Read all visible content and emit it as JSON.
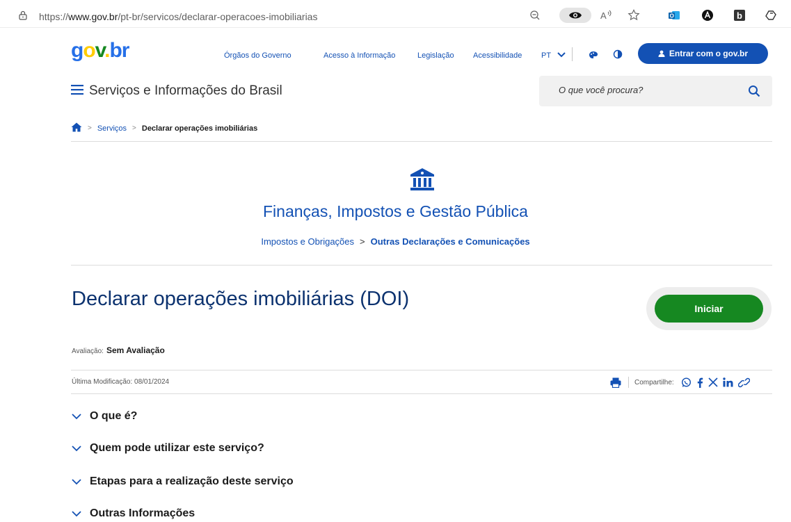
{
  "browser": {
    "url_prefix": "https://",
    "url_domain": "www.gov.br",
    "url_path": "/pt-br/servicos/declarar-operacoes-imobiliarias",
    "icons": [
      "lock-icon",
      "zoom-out-icon",
      "eye-icon",
      "read-aloud-icon",
      "favorite-star-icon",
      "outlook-icon",
      "extension-a-icon",
      "extension-b-icon",
      "copilot-icon"
    ]
  },
  "header": {
    "logo": {
      "g": "g",
      "o": "o",
      "v": "v",
      "dot": ".",
      "br": "br"
    },
    "nav": [
      "Órgãos do Governo",
      "Acesso à Informação",
      "Legislação",
      "Acessibilidade"
    ],
    "language": "PT",
    "login_label": "Entrar com o gov.br",
    "site_title": "Serviços e Informações do Brasil",
    "search_placeholder": "O que você procura?"
  },
  "breadcrumb": {
    "items": [
      "Serviços",
      "Declarar operações imobiliárias"
    ]
  },
  "category": {
    "title": "Finanças, Impostos e Gestão Pública",
    "sub_link": "Impostos e Obrigações",
    "sub_current": "Outras Declarações e Comunicações"
  },
  "service": {
    "title": "Declarar operações imobiliárias (DOI)",
    "start_label": "Iniciar",
    "rating_label": "Avaliação:",
    "rating_value": "Sem Avaliação",
    "modified": "Última Modificação: 08/01/2024",
    "share_label": "Compartilhe:"
  },
  "accordion": [
    "O que é?",
    "Quem pode utilizar este serviço?",
    "Etapas para a realização deste serviço",
    "Outras Informações"
  ],
  "colors": {
    "primary": "#1351b4",
    "title": "#0c326f",
    "start": "#168821"
  }
}
